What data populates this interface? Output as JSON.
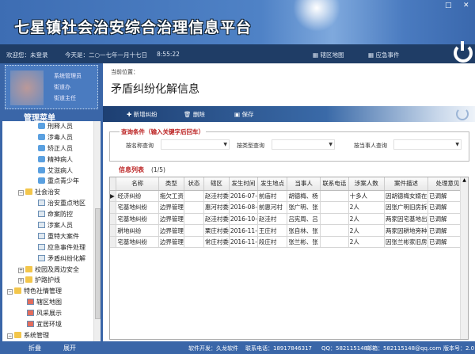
{
  "app": {
    "title": "七星镇社会治安综合治理信息平台"
  },
  "navbar": {
    "welcome": "欢迎您：未登录",
    "date": "今天是：二○一七年一月十七日",
    "time": "8:55:22",
    "links": [
      "辖区地图",
      "应急事件"
    ]
  },
  "user": {
    "lines": [
      "系统管理员",
      "街道办",
      "街道主任"
    ]
  },
  "menu": {
    "title": "管理菜单",
    "items": [
      {
        "label": "刑释人员",
        "icon": "user-icon",
        "level": 2
      },
      {
        "label": "涉毒人员",
        "icon": "user-icon",
        "level": 2
      },
      {
        "label": "矫正人员",
        "icon": "user-icon",
        "level": 2
      },
      {
        "label": "精神病人",
        "icon": "user-icon",
        "level": 2
      },
      {
        "label": "艾滋病人",
        "icon": "user-icon",
        "level": 2
      },
      {
        "label": "重点青少年",
        "icon": "user-icon",
        "level": 2
      },
      {
        "label": "社会治安",
        "icon": "folder-icon",
        "level": 1,
        "toggle": "-"
      },
      {
        "label": "治安重点地区",
        "icon": "doc-icon",
        "level": 2
      },
      {
        "label": "命案防控",
        "icon": "doc-icon",
        "level": 2
      },
      {
        "label": "涉案人员",
        "icon": "doc-icon",
        "level": 2
      },
      {
        "label": "重特大案件",
        "icon": "doc-icon",
        "level": 2
      },
      {
        "label": "应急事件处理",
        "icon": "doc-icon",
        "level": 2
      },
      {
        "label": "矛盾纠纷化解",
        "icon": "doc-icon",
        "level": 2
      },
      {
        "label": "校园及周边安全",
        "icon": "folder-icon",
        "level": 1,
        "toggle": "+"
      },
      {
        "label": "护路护线",
        "icon": "folder-icon",
        "level": 1,
        "toggle": "+"
      },
      {
        "label": "特色社情管理",
        "icon": "folder-icon",
        "level": 0,
        "toggle": "-"
      },
      {
        "label": "辖区地图",
        "icon": "map-icon",
        "level": 1
      },
      {
        "label": "风采展示",
        "icon": "map-icon",
        "level": 1
      },
      {
        "label": "宜居环境",
        "icon": "map-icon",
        "level": 1
      },
      {
        "label": "系统管理",
        "icon": "folder-icon",
        "level": 0,
        "toggle": "-"
      }
    ],
    "collapse": "折叠",
    "expand": "展开"
  },
  "main": {
    "breadcrumb": "当前位置：",
    "title": "矛盾纠纷化解信息",
    "toolbar": {
      "add": "新增纠纷",
      "delete": "删除",
      "save": "保存"
    },
    "query": {
      "legend": "查询条件（输入关键字后回车）",
      "by_name": "按名称查询",
      "by_type": "按类型查询",
      "by_party": "按当事人查询"
    },
    "list": {
      "label": "信息列表",
      "count": "(1/5)",
      "columns": [
        "名称",
        "类型",
        "状态",
        "辖区",
        "发生时间",
        "发生地点",
        "当事人",
        "联系电话",
        "涉案人数",
        "案件描述",
        "处理意见"
      ],
      "rows": [
        [
          "经济纠纷",
          "拖欠工资",
          "",
          "赵洼村委",
          "2016-07-",
          "前庙村",
          "胡德梅、杨",
          "",
          "十多人",
          "因胡德梅女婿在",
          "已调解"
        ],
        [
          "宅基地纠纷",
          "边界管理",
          "",
          "惠河村委",
          "2016-08-",
          "前惠河村",
          "张广明、张",
          "",
          "2人",
          "因张广明旧房拆",
          "已调解"
        ],
        [
          "宅基地纠纷",
          "边界管理",
          "",
          "赵洼村委",
          "2016-10-",
          "赵洼村",
          "吕宪周、吕",
          "",
          "2人",
          "两家因宅基地出",
          "已调解"
        ],
        [
          "耕地纠纷",
          "边界管理",
          "",
          "栗庄村委",
          "2016-11-",
          "王庄村",
          "张自林、张",
          "",
          "2人",
          "两家因耕地旁种",
          "已调解"
        ],
        [
          "宅基地纠纷",
          "边界管理",
          "",
          "常庄村委",
          "2016-11-",
          "段庄村",
          "张兰彬、张",
          "",
          "2人",
          "因张兰彬家旧房",
          "已调解"
        ]
      ]
    }
  },
  "footer": {
    "developer": "软件开发：久龙软件",
    "phone": "联系电话：18917846317",
    "qq": "QQ：582115148",
    "email": "邮箱：582115148@qq.com",
    "version": "版本号：2.0"
  }
}
